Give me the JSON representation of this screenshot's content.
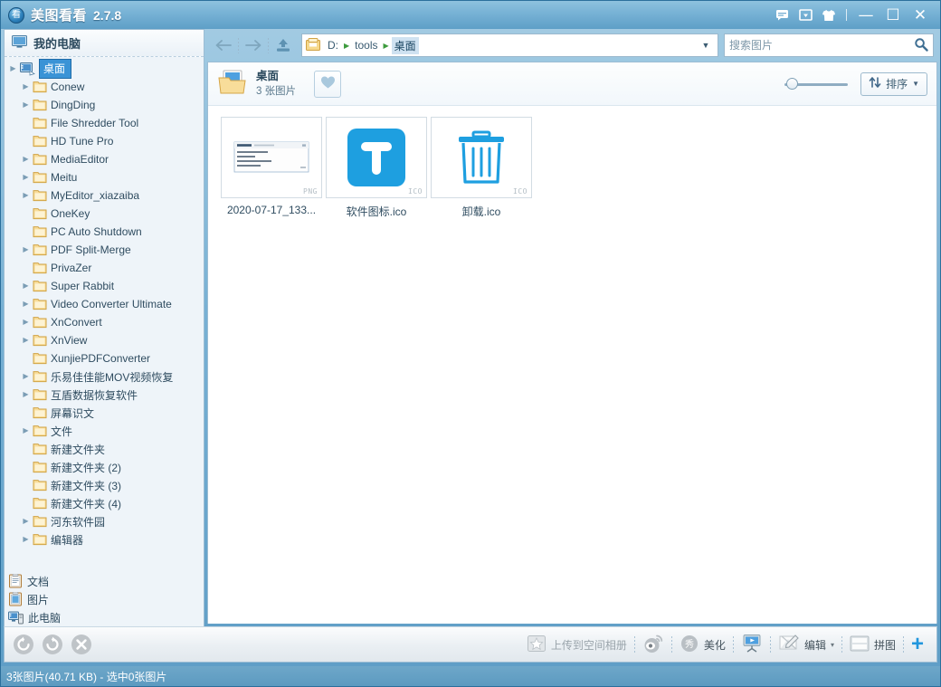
{
  "window": {
    "title": "美图看看",
    "version": "2.7.8",
    "logo_glyph": "看",
    "controls": {
      "feedback": "feedback-icon",
      "dropdown": "dropdown-icon",
      "skin": "skin-icon",
      "minimize": "—",
      "maximize": "☐",
      "close": "✕"
    }
  },
  "sidebar": {
    "header": "我的电脑",
    "tree": [
      {
        "label": "桌面",
        "icon": "desktop-icon",
        "arrow": true,
        "selected": true,
        "indent": 0
      },
      {
        "label": "Conew",
        "icon": "folder-icon",
        "arrow": true,
        "selected": false,
        "indent": 1
      },
      {
        "label": "DingDing",
        "icon": "folder-icon",
        "arrow": true,
        "selected": false,
        "indent": 1
      },
      {
        "label": "File Shredder Tool",
        "icon": "folder-icon",
        "arrow": false,
        "selected": false,
        "indent": 1
      },
      {
        "label": "HD Tune Pro",
        "icon": "folder-icon",
        "arrow": false,
        "selected": false,
        "indent": 1
      },
      {
        "label": "MediaEditor",
        "icon": "folder-icon",
        "arrow": true,
        "selected": false,
        "indent": 1
      },
      {
        "label": "Meitu",
        "icon": "folder-icon",
        "arrow": true,
        "selected": false,
        "indent": 1
      },
      {
        "label": "MyEditor_xiazaiba",
        "icon": "folder-icon",
        "arrow": true,
        "selected": false,
        "indent": 1
      },
      {
        "label": "OneKey",
        "icon": "folder-icon",
        "arrow": false,
        "selected": false,
        "indent": 1
      },
      {
        "label": "PC Auto Shutdown",
        "icon": "folder-icon",
        "arrow": false,
        "selected": false,
        "indent": 1
      },
      {
        "label": "PDF Split-Merge",
        "icon": "folder-icon",
        "arrow": true,
        "selected": false,
        "indent": 1
      },
      {
        "label": "PrivaZer",
        "icon": "folder-icon",
        "arrow": false,
        "selected": false,
        "indent": 1
      },
      {
        "label": "Super Rabbit",
        "icon": "folder-icon",
        "arrow": true,
        "selected": false,
        "indent": 1
      },
      {
        "label": "Video Converter Ultimate",
        "icon": "folder-icon",
        "arrow": true,
        "selected": false,
        "indent": 1
      },
      {
        "label": "XnConvert",
        "icon": "folder-icon",
        "arrow": true,
        "selected": false,
        "indent": 1
      },
      {
        "label": "XnView",
        "icon": "folder-icon",
        "arrow": true,
        "selected": false,
        "indent": 1
      },
      {
        "label": "XunjiePDFConverter",
        "icon": "folder-icon",
        "arrow": false,
        "selected": false,
        "indent": 1
      },
      {
        "label": "乐易佳佳能MOV视频恢复",
        "icon": "folder-icon",
        "arrow": true,
        "selected": false,
        "indent": 1
      },
      {
        "label": "互盾数据恢复软件",
        "icon": "folder-icon",
        "arrow": true,
        "selected": false,
        "indent": 1
      },
      {
        "label": "屏幕识文",
        "icon": "folder-icon",
        "arrow": false,
        "selected": false,
        "indent": 1
      },
      {
        "label": "文件",
        "icon": "folder-icon",
        "arrow": true,
        "selected": false,
        "indent": 1
      },
      {
        "label": "新建文件夹",
        "icon": "folder-icon",
        "arrow": false,
        "selected": false,
        "indent": 1
      },
      {
        "label": "新建文件夹 (2)",
        "icon": "folder-icon",
        "arrow": false,
        "selected": false,
        "indent": 1
      },
      {
        "label": "新建文件夹 (3)",
        "icon": "folder-icon",
        "arrow": false,
        "selected": false,
        "indent": 1
      },
      {
        "label": "新建文件夹 (4)",
        "icon": "folder-icon",
        "arrow": false,
        "selected": false,
        "indent": 1
      },
      {
        "label": "河东软件园",
        "icon": "folder-icon",
        "arrow": true,
        "selected": false,
        "indent": 1
      },
      {
        "label": "编辑器",
        "icon": "folder-icon",
        "arrow": true,
        "selected": false,
        "indent": 1
      }
    ],
    "places": [
      {
        "label": "文档",
        "icon": "documents-icon"
      },
      {
        "label": "图片",
        "icon": "pictures-icon"
      },
      {
        "label": "此电脑",
        "icon": "this-pc-icon"
      }
    ]
  },
  "nav": {
    "back": "back-arrow-icon",
    "forward": "forward-arrow-icon",
    "upload": "upload-icon",
    "breadcrumb": [
      {
        "label": "D:",
        "active": false
      },
      {
        "label": "tools",
        "active": false
      },
      {
        "label": "桌面",
        "active": true
      }
    ]
  },
  "search": {
    "placeholder": "搜索图片",
    "value": "",
    "icon": "search-icon"
  },
  "folderbar": {
    "name": "桌面",
    "count_text": "3 张图片",
    "favorite_icon": "heart-icon",
    "zoom_slider_value": 3,
    "sort_label": "排序",
    "sort_icon": "sort-icon",
    "sort_caret": "▼"
  },
  "thumbnails": [
    {
      "name": "2020-07-17_133...",
      "format": "PNG",
      "kind": "screenshot-preview"
    },
    {
      "name": "软件图标.ico",
      "format": "ICO",
      "kind": "blue-t-icon"
    },
    {
      "name": "卸载.ico",
      "format": "ICO",
      "kind": "trash-icon"
    }
  ],
  "bottombar": {
    "left": [
      {
        "name": "rotate-left-icon",
        "label": ""
      },
      {
        "name": "rotate-right-icon",
        "label": ""
      },
      {
        "name": "delete-icon",
        "label": ""
      }
    ],
    "upload_label": "上传到空间相册",
    "weibo_icon": "weibo-icon",
    "beautify_label": "美化",
    "beautify_icon": "beautify-icon",
    "slideshow_icon": "slideshow-icon",
    "edit_label": "编辑",
    "edit_icon": "edit-pen-icon",
    "edit_caret": "▾",
    "collage_label": "拼图",
    "collage_icon": "collage-icon",
    "add_label": "+"
  },
  "statusbar": {
    "text": "3张图片(40.71 KB) - 选中0张图片"
  },
  "colors": {
    "accent": "#2196dd",
    "titlebar": "#79b3d6",
    "selection": "#3a93d6",
    "status_bg": "#5c9ac0",
    "folder": "#f7d98a"
  }
}
